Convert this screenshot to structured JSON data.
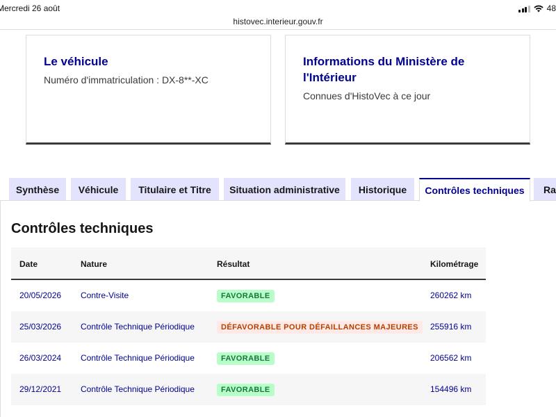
{
  "status_bar": {
    "time": "Mercredi 26 août",
    "battery": "48"
  },
  "browser": {
    "url": "histovec.interieur.gouv.fr"
  },
  "cards": {
    "vehicle": {
      "title": "Le véhicule",
      "description": "Numéro d'immatriculation : DX-8**-XC"
    },
    "ministry": {
      "title": "Informations du Ministère de l'Intérieur",
      "description": "Connues d'HistoVec à ce jour"
    }
  },
  "tabs": [
    {
      "label": "Synthèse"
    },
    {
      "label": "Véhicule"
    },
    {
      "label": "Titulaire et Titre"
    },
    {
      "label": "Situation administrative"
    },
    {
      "label": "Historique"
    },
    {
      "label": "Contrôles techniques",
      "active": true
    },
    {
      "label": "Rap"
    }
  ],
  "section": {
    "title": "Contrôles techniques"
  },
  "table": {
    "headers": {
      "date": "Date",
      "nature": "Nature",
      "result": "Résultat",
      "km": "Kilométrage"
    },
    "rows": [
      {
        "date": "20/05/2026",
        "nature": "Contre-Visite",
        "result": "FAVORABLE",
        "km": "260262 km",
        "status": "ok"
      },
      {
        "date": "25/03/2026",
        "nature": "Contrôle Technique Périodique",
        "result": "DÉFAVORABLE POUR DÉFAILLANCES MAJEURES",
        "km": "255916 km",
        "status": "ko"
      },
      {
        "date": "26/03/2024",
        "nature": "Contrôle Technique Périodique",
        "result": "FAVORABLE",
        "km": "206562 km",
        "status": "ok"
      },
      {
        "date": "29/12/2021",
        "nature": "Contrôle Technique Périodique",
        "result": "FAVORABLE",
        "km": "154496 km",
        "status": "ok"
      }
    ]
  },
  "colors": {
    "primary": "#000091",
    "tab_bg": "#e3e3fd",
    "success_bg": "#b8fec9",
    "success_text": "#18753c",
    "error_bg": "#ffe9e6",
    "error_text": "#b34000"
  }
}
